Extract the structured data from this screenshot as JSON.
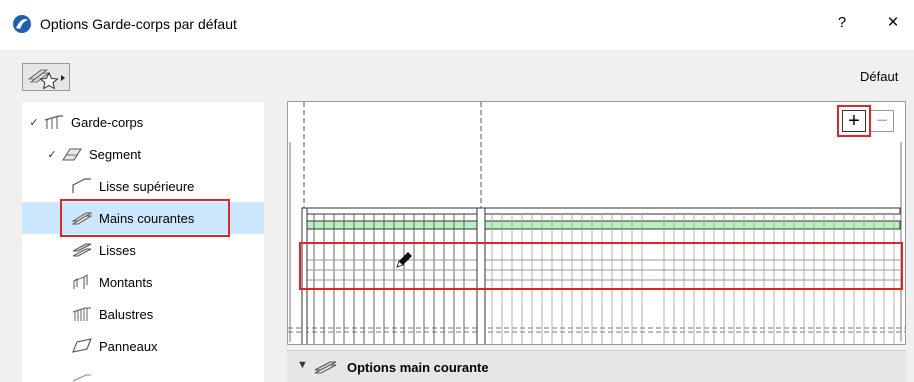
{
  "window": {
    "title": "Options Garde-corps par défaut",
    "help_label": "?",
    "close_label": "×"
  },
  "toolbar": {
    "favorites_icon": "favorites-star-icon",
    "default_label": "Défaut"
  },
  "tree": {
    "items": [
      {
        "label": "Garde-corps",
        "icon": "railing-icon",
        "expanded": true,
        "selected": false
      },
      {
        "label": "Segment",
        "icon": "segment-icon",
        "expanded": true,
        "selected": false
      },
      {
        "label": "Lisse supérieure",
        "icon": "top-rail-icon",
        "selected": false
      },
      {
        "label": "Mains courantes",
        "icon": "handrail-icon",
        "selected": true
      },
      {
        "label": "Lisses",
        "icon": "rails-icon",
        "selected": false
      },
      {
        "label": "Montants",
        "icon": "posts-icon",
        "selected": false
      },
      {
        "label": "Balustres",
        "icon": "balusters-icon",
        "selected": false
      },
      {
        "label": "Panneaux",
        "icon": "panels-icon",
        "selected": false
      }
    ]
  },
  "preview": {
    "add_label": "+",
    "remove_label": "−",
    "pencil_icon": "pencil-icon"
  },
  "section": {
    "label": "Options main courante",
    "icon": "handrail-icon",
    "expanded": true
  },
  "colors": {
    "dialog_bg": "#f0f0f0",
    "selected_bg": "#cce8ff",
    "highlight_red": "#e0262b",
    "handrail_green": "#b8f0c0",
    "title_icon_blue": "#1f5fae"
  }
}
